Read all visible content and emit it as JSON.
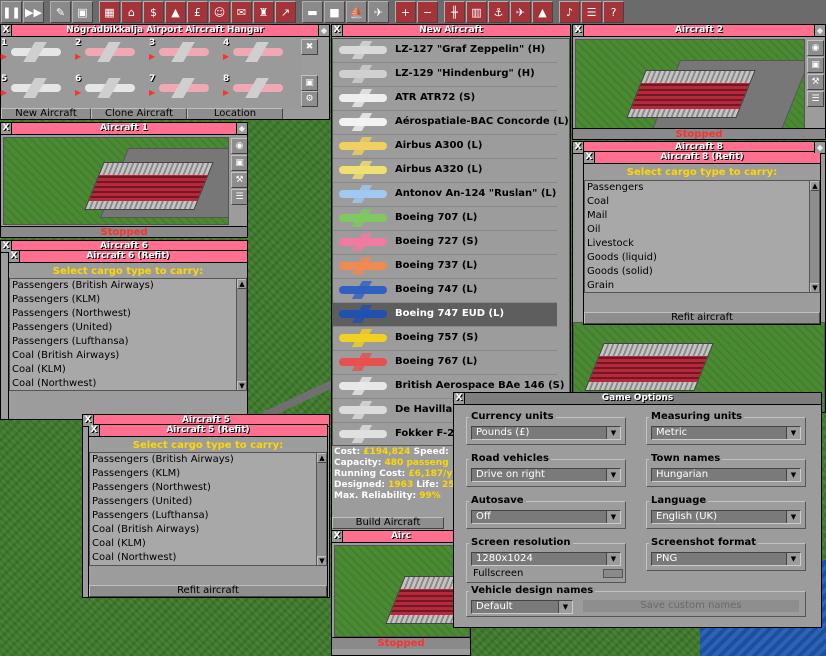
{
  "toolbar": {
    "icons": [
      "pause",
      "fast-forward",
      "settings",
      "save",
      "map",
      "town-directory",
      "subsidies",
      "stations",
      "finances",
      "company",
      "stories",
      "league",
      "graph",
      "rail",
      "road",
      "water",
      "air",
      "zoom-in",
      "zoom-out",
      "rail-build",
      "road-build",
      "dock-build",
      "air-build",
      "landscape",
      "music",
      "news",
      "help"
    ]
  },
  "hangar": {
    "title": "Nógrádbikkalja Airport Aircraft Hangar",
    "slots": [
      "1",
      "2",
      "3",
      "4",
      "5",
      "6",
      "7",
      "8"
    ],
    "buttons": {
      "new": "New Aircraft",
      "clone": "Clone Aircraft",
      "location": "Location"
    }
  },
  "aircraft1": {
    "title": "Aircraft 1",
    "status": "Stopped"
  },
  "aircraft2": {
    "title": "Aircraft 2",
    "status": "Stopped"
  },
  "aircraft6": {
    "title": "Aircraft 6",
    "refit_title": "Aircraft 6 (Refit)",
    "hint": "Select cargo type to carry:",
    "cargo": [
      "Passengers (British Airways)",
      "Passengers (KLM)",
      "Passengers (Northwest)",
      "Passengers (United)",
      "Passengers (Lufthansa)",
      "Coal (British Airways)",
      "Coal (KLM)",
      "Coal (Northwest)"
    ]
  },
  "aircraft5": {
    "title": "Aircraft 5",
    "refit_title": "Aircraft 5 (Refit)",
    "hint": "Select cargo type to carry:",
    "cargo": [
      "Passengers (British Airways)",
      "Passengers (KLM)",
      "Passengers (Northwest)",
      "Passengers (United)",
      "Passengers (Lufthansa)",
      "Coal (British Airways)",
      "Coal (KLM)",
      "Coal (Northwest)"
    ],
    "refit_button": "Refit aircraft"
  },
  "aircraft8": {
    "title": "Aircraft 8",
    "refit_title": "Aircraft 8 (Refit)",
    "hint": "Select cargo type to carry:",
    "cargo": [
      "Passengers",
      "Coal",
      "Mail",
      "Oil",
      "Livestock",
      "Goods (liquid)",
      "Goods (solid)",
      "Grain"
    ],
    "refit_button": "Refit aircraft"
  },
  "aircraft_bottom": {
    "title": "Airc",
    "status": "Stopped"
  },
  "new_aircraft": {
    "title": "New Aircraft",
    "models": [
      {
        "name": "LZ-127 \"Graf Zeppelin\" (H)",
        "color": "#d9d9d9"
      },
      {
        "name": "LZ-129 \"Hindenburg\" (H)",
        "color": "#d0d0d0"
      },
      {
        "name": "ATR ATR72 (S)",
        "color": "#eeeeee"
      },
      {
        "name": "Aérospatiale-BAC Concorde (L)",
        "color": "#f2f2f2"
      },
      {
        "name": "Airbus A300 (L)",
        "color": "#f0d060"
      },
      {
        "name": "Airbus A320 (L)",
        "color": "#f0e070"
      },
      {
        "name": "Antonov An-124 \"Ruslan\" (L)",
        "color": "#a0c8f0"
      },
      {
        "name": "Boeing 707 (L)",
        "color": "#80c860"
      },
      {
        "name": "Boeing 727 (S)",
        "color": "#f07aa0"
      },
      {
        "name": "Boeing 737 (L)",
        "color": "#f08a50"
      },
      {
        "name": "Boeing 747 (L)",
        "color": "#3060c0"
      },
      {
        "name": "Boeing 747 EUD (L)",
        "color": "#2050b0"
      },
      {
        "name": "Boeing 757 (S)",
        "color": "#f0d020"
      },
      {
        "name": "Boeing 767 (L)",
        "color": "#e85050"
      },
      {
        "name": "British Aerospace BAe 146 (S)",
        "color": "#e8e8e8"
      },
      {
        "name": "De Havillan",
        "color": "#dcdcdc"
      },
      {
        "name": "Fokker F-2",
        "color": "#e0e0e0"
      }
    ],
    "info": {
      "cost_label": "Cost:",
      "cost": "£194,824",
      "speed_label": "Speed:",
      "capacity_label": "Capacity:",
      "capacity": "480 passeng",
      "running_label": "Running Cost:",
      "running": "£6,187/y",
      "designed_label": "Designed:",
      "designed": "1963",
      "life_label": "Life:",
      "life": "25",
      "reliability_label": "Max. Reliability:",
      "reliability": "99%"
    },
    "build_button": "Build Aircraft"
  },
  "game_options": {
    "title": "Game Options",
    "currency": {
      "label": "Currency units",
      "value": "Pounds (£)"
    },
    "measuring": {
      "label": "Measuring units",
      "value": "Metric"
    },
    "road": {
      "label": "Road vehicles",
      "value": "Drive on right"
    },
    "town_names": {
      "label": "Town names",
      "value": "Hungarian"
    },
    "autosave": {
      "label": "Autosave",
      "value": "Off"
    },
    "language": {
      "label": "Language",
      "value": "English (UK)"
    },
    "resolution": {
      "label": "Screen resolution",
      "value": "1280x1024",
      "fullscreen": "Fullscreen"
    },
    "screenshot": {
      "label": "Screenshot format",
      "value": "PNG"
    },
    "design_names": {
      "label": "Vehicle design names",
      "value": "Default",
      "save_button": "Save custom names"
    }
  }
}
